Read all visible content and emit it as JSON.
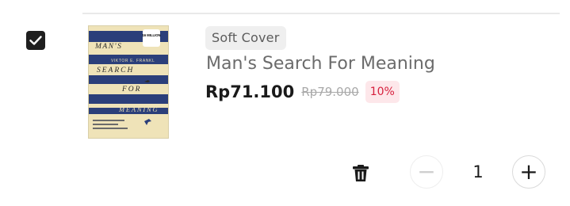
{
  "cart_item": {
    "checked": true,
    "variant": "Soft Cover",
    "title": "Man's Search For Meaning",
    "price": "Rp71.100",
    "original_price": "Rp79.000",
    "discount": "10%",
    "quantity": "1",
    "cover": {
      "lines": [
        "MAN'S",
        "SEARCH",
        "FOR",
        "MEANING"
      ],
      "author": "VIKTOR E. FRANKL",
      "badge": "16 MILLION"
    }
  },
  "controls": {
    "minus_label": "−",
    "plus_label": "+"
  },
  "colors": {
    "checkbox": "#1f1f1f",
    "discount_text": "#d61f3c",
    "discount_bg": "#fde7ea",
    "cover_bg": "#efe3b8",
    "cover_stripe": "#2b3f7a"
  }
}
